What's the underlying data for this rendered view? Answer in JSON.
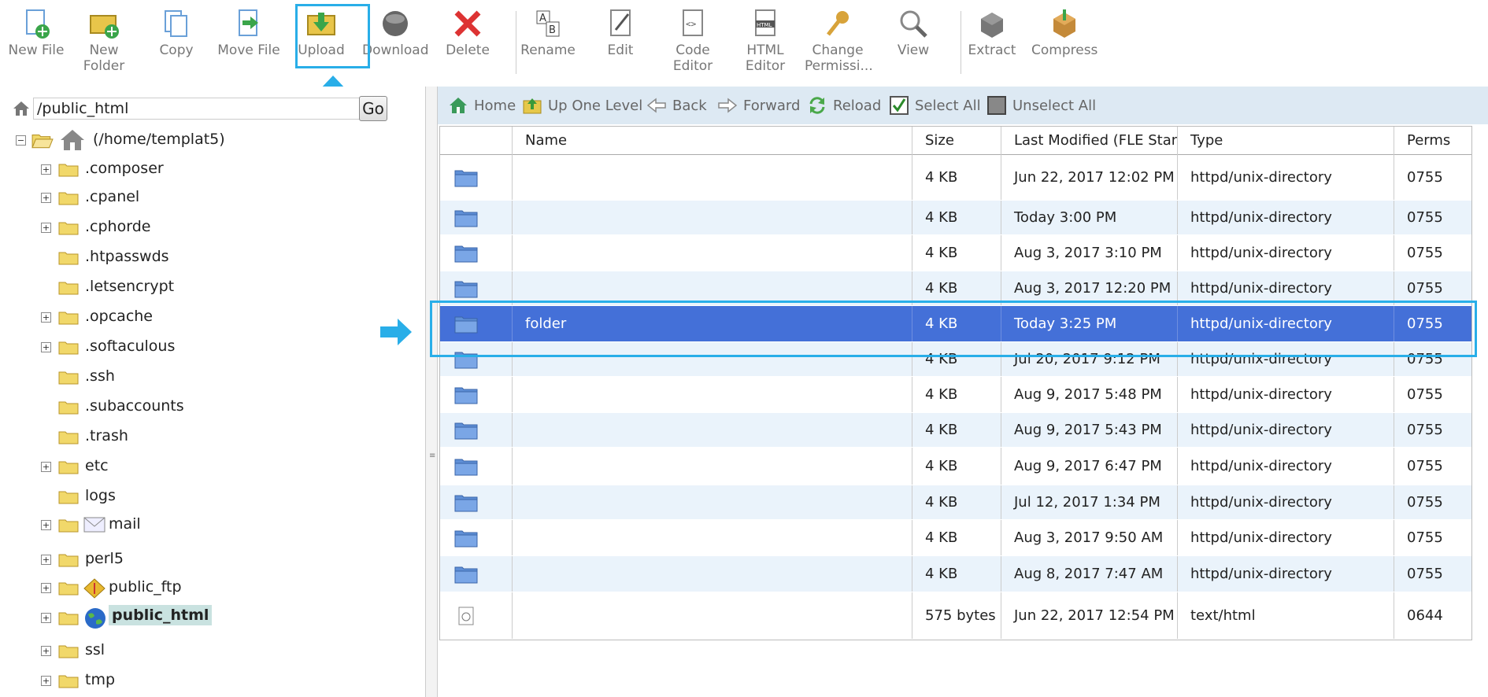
{
  "toolbar": {
    "buttons": [
      {
        "label": "New File",
        "icon": "new-file-icon"
      },
      {
        "label": "New Folder",
        "icon": "new-folder-icon"
      },
      {
        "label": "Copy",
        "icon": "copy-icon"
      },
      {
        "label": "Move File",
        "icon": "move-file-icon"
      },
      {
        "label": "Upload",
        "icon": "upload-icon"
      },
      {
        "label": "Download",
        "icon": "download-icon"
      },
      {
        "label": "Delete",
        "icon": "delete-icon"
      },
      {
        "label": "Rename",
        "icon": "rename-icon"
      },
      {
        "label": "Edit",
        "icon": "edit-icon"
      },
      {
        "label": "Code Editor",
        "icon": "code-editor-icon"
      },
      {
        "label": "HTML Editor",
        "icon": "html-editor-icon"
      },
      {
        "label": "Change Permissi...",
        "icon": "permissions-icon"
      },
      {
        "label": "View",
        "icon": "view-icon"
      },
      {
        "label": "Extract",
        "icon": "extract-icon"
      },
      {
        "label": "Compress",
        "icon": "compress-icon"
      }
    ]
  },
  "path": {
    "value": "/public_html",
    "go_label": "Go"
  },
  "tree": {
    "root": "(/home/templat5)",
    "items": [
      {
        "label": ".composer",
        "expandable": true
      },
      {
        "label": ".cpanel",
        "expandable": true
      },
      {
        "label": ".cphorde",
        "expandable": true
      },
      {
        "label": ".htpasswds",
        "expandable": false
      },
      {
        "label": ".letsencrypt",
        "expandable": false
      },
      {
        "label": ".opcache",
        "expandable": true
      },
      {
        "label": ".softaculous",
        "expandable": true
      },
      {
        "label": ".ssh",
        "expandable": false
      },
      {
        "label": ".subaccounts",
        "expandable": false
      },
      {
        "label": ".trash",
        "expandable": false
      },
      {
        "label": "etc",
        "expandable": true
      },
      {
        "label": "logs",
        "expandable": false
      },
      {
        "label": "mail",
        "expandable": true
      },
      {
        "label": "perl5",
        "expandable": true
      },
      {
        "label": "public_ftp",
        "expandable": true
      },
      {
        "label": "public_html",
        "expandable": true,
        "selected": true
      },
      {
        "label": "ssl",
        "expandable": true
      },
      {
        "label": "tmp",
        "expandable": true
      }
    ]
  },
  "nav": {
    "home": "Home",
    "up": "Up One Level",
    "back": "Back",
    "forward": "Forward",
    "reload": "Reload",
    "select_all": "Select All",
    "unselect_all": "Unselect All"
  },
  "table": {
    "columns": [
      "Name",
      "Size",
      "Last Modified (FLE Standard)",
      "Type",
      "Perms"
    ],
    "rows": [
      {
        "name": "",
        "size": "4 KB",
        "modified": "Jun 22, 2017 12:02 PM",
        "type": "httpd/unix-directory",
        "perms": "0755",
        "kind": "folder"
      },
      {
        "name": "",
        "size": "4 KB",
        "modified": "Today 3:00 PM",
        "type": "httpd/unix-directory",
        "perms": "0755",
        "kind": "folder"
      },
      {
        "name": "",
        "size": "4 KB",
        "modified": "Aug 3, 2017 3:10 PM",
        "type": "httpd/unix-directory",
        "perms": "0755",
        "kind": "folder"
      },
      {
        "name": "",
        "size": "4 KB",
        "modified": "Aug 3, 2017 12:20 PM",
        "type": "httpd/unix-directory",
        "perms": "0755",
        "kind": "folder"
      },
      {
        "name": "folder",
        "size": "4 KB",
        "modified": "Today 3:25 PM",
        "type": "httpd/unix-directory",
        "perms": "0755",
        "kind": "folder",
        "selected": true
      },
      {
        "name": "",
        "size": "4 KB",
        "modified": "Jul 20, 2017 9:12 PM",
        "type": "httpd/unix-directory",
        "perms": "0755",
        "kind": "folder"
      },
      {
        "name": "",
        "size": "4 KB",
        "modified": "Aug 9, 2017 5:48 PM",
        "type": "httpd/unix-directory",
        "perms": "0755",
        "kind": "folder"
      },
      {
        "name": "",
        "size": "4 KB",
        "modified": "Aug 9, 2017 5:43 PM",
        "type": "httpd/unix-directory",
        "perms": "0755",
        "kind": "folder"
      },
      {
        "name": "",
        "size": "4 KB",
        "modified": "Aug 9, 2017 6:47 PM",
        "type": "httpd/unix-directory",
        "perms": "0755",
        "kind": "folder"
      },
      {
        "name": "",
        "size": "4 KB",
        "modified": "Jul 12, 2017 1:34 PM",
        "type": "httpd/unix-directory",
        "perms": "0755",
        "kind": "folder"
      },
      {
        "name": "",
        "size": "4 KB",
        "modified": "Aug 3, 2017 9:50 AM",
        "type": "httpd/unix-directory",
        "perms": "0755",
        "kind": "folder"
      },
      {
        "name": "",
        "size": "4 KB",
        "modified": "Aug 8, 2017 7:47 AM",
        "type": "httpd/unix-directory",
        "perms": "0755",
        "kind": "folder"
      },
      {
        "name": "",
        "size": "575 bytes",
        "modified": "Jun 22, 2017 12:54 PM",
        "type": "text/html",
        "perms": "0644",
        "kind": "file"
      }
    ]
  },
  "colors": {
    "accent_highlight": "#29aee8",
    "selected_row": "#4470d8",
    "odd_row": "#eaf3fb",
    "nav_bar": "#dde9f3"
  }
}
